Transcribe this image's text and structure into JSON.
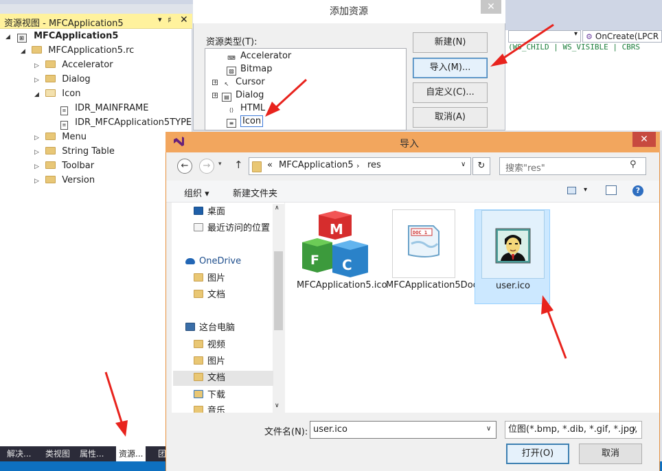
{
  "resource_view": {
    "title": "资源视图 - MFCApplication5",
    "pin": "▾",
    "pin2": "♯",
    "close": "✕",
    "tree": [
      {
        "label": "MFCApplication5",
        "level": 0,
        "expander": "◢",
        "bold": true
      },
      {
        "label": "MFCApplication5.rc",
        "level": 1,
        "expander": "◢"
      },
      {
        "label": "Accelerator",
        "level": 2,
        "expander": "▷"
      },
      {
        "label": "Dialog",
        "level": 2,
        "expander": "▷"
      },
      {
        "label": "Icon",
        "level": 2,
        "expander": "◢"
      },
      {
        "label": "IDR_MAINFRAME",
        "level": 3
      },
      {
        "label": "IDR_MFCApplication5TYPE",
        "level": 3
      },
      {
        "label": "Menu",
        "level": 2,
        "expander": "▷"
      },
      {
        "label": "String Table",
        "level": 2,
        "expander": "▷"
      },
      {
        "label": "Toolbar",
        "level": 2,
        "expander": "▷"
      },
      {
        "label": "Version",
        "level": 2,
        "expander": "▷"
      }
    ],
    "bottom_tabs": [
      "解决...",
      "类视图",
      "属性...",
      "资源...",
      "团"
    ]
  },
  "code_editor": {
    "member_dropdown": "OnCreate(LPCR",
    "member_icon": "⚙",
    "code_snippet": "(WS_CHILD | WS_VISIBLE | CBRS"
  },
  "add_resource_dialog": {
    "title": "添加资源",
    "close": "✕",
    "type_label": "资源类型(T):",
    "types": [
      {
        "label": "Accelerator",
        "expandable": false
      },
      {
        "label": "Bitmap",
        "expandable": false
      },
      {
        "label": "Cursor",
        "expandable": true
      },
      {
        "label": "Dialog",
        "expandable": true
      },
      {
        "label": "HTML",
        "expandable": false
      },
      {
        "label": "Icon",
        "expandable": false,
        "selected": true
      }
    ],
    "buttons": {
      "new": "新建(N)",
      "import": "导入(M)...",
      "custom": "自定义(C)...",
      "cancel": "取消(A)"
    }
  },
  "import_dialog": {
    "title": "导入",
    "close": "✕",
    "nav": {
      "back": "←",
      "forward": "→",
      "recent": "▾",
      "up": "↑",
      "refresh": "↻"
    },
    "address": {
      "overflow": "«",
      "segments": [
        "MFCApplication5",
        "res"
      ],
      "separator": "›",
      "drop": "∨"
    },
    "search_placeholder": "搜索\"res\"",
    "search_icon": "⚲",
    "toolbar": {
      "organize": "组织 ▾",
      "new_folder": "新建文件夹",
      "view_drop": "▾",
      "help": "?"
    },
    "sidebar": [
      {
        "label": "桌面",
        "icon": "desktop",
        "indent": 1
      },
      {
        "label": "最近访问的位置",
        "icon": "recent",
        "indent": 1
      },
      {
        "label": "OneDrive",
        "icon": "cloud",
        "indent": 0
      },
      {
        "label": "图片",
        "icon": "folder",
        "indent": 1
      },
      {
        "label": "文档",
        "icon": "folder",
        "indent": 1
      },
      {
        "label": "这台电脑",
        "icon": "pc",
        "indent": 0
      },
      {
        "label": "视频",
        "icon": "folder",
        "indent": 1
      },
      {
        "label": "图片",
        "icon": "folder",
        "indent": 1
      },
      {
        "label": "文档",
        "icon": "folder",
        "indent": 1,
        "selected": true
      },
      {
        "label": "下载",
        "icon": "download",
        "indent": 1
      },
      {
        "label": "音乐",
        "icon": "folder",
        "indent": 1
      }
    ],
    "scroll": {
      "up": "∧",
      "down": "∨"
    },
    "files": [
      {
        "name": "MFCApplication5.ico",
        "thumb": "mfc-cubes",
        "letters": [
          "M",
          "F",
          "C"
        ]
      },
      {
        "name": "MFCApplication5Doc.ico",
        "thumb": "doc",
        "doc_tag": "DOC 1"
      },
      {
        "name": "user.ico",
        "thumb": "user",
        "selected": true
      }
    ],
    "filename_label": "文件名(N):",
    "filename_value": "user.ico",
    "filter_value": "位图(*.bmp, *.dib, *.gif, *.jpg,",
    "drop": "∨",
    "open_button": "打开(O)",
    "cancel_button": "取消"
  },
  "colors": {
    "panel_title": "#fff29d",
    "import_titlebar": "#f2a65e",
    "close_red": "#c74a3f",
    "selection": "#cce8ff",
    "annotation_arrow": "#e8231d",
    "status_bar": "#0e70c0"
  }
}
